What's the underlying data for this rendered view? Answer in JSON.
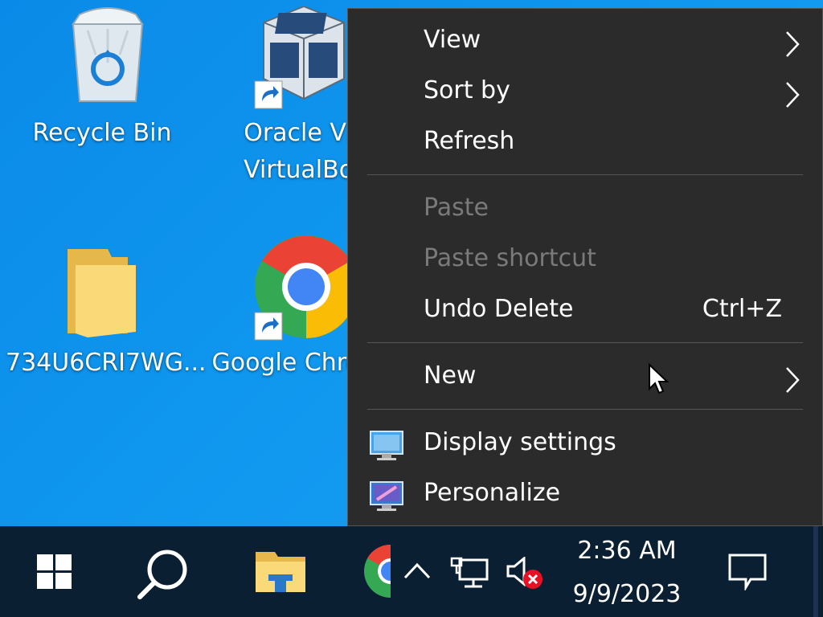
{
  "desktop": {
    "icons": [
      {
        "label_lines": [
          "Recycle Bin"
        ],
        "icon": "recycle-bin-icon"
      },
      {
        "label_lines": [
          "Oracle VM",
          "VirtualBox"
        ],
        "icon": "virtualbox-icon"
      },
      {
        "label_lines": [
          "734U6CRI7WG..."
        ],
        "icon": "folder-icon"
      },
      {
        "label_lines": [
          "Google Chrome"
        ],
        "icon": "chrome-icon"
      }
    ]
  },
  "context_menu": {
    "items": [
      {
        "label": "View",
        "has_submenu": true,
        "enabled": true
      },
      {
        "label": "Sort by",
        "has_submenu": true,
        "enabled": true
      },
      {
        "label": "Refresh",
        "enabled": true
      },
      {
        "label": "Paste",
        "enabled": false
      },
      {
        "label": "Paste shortcut",
        "enabled": false
      },
      {
        "label": "Undo Delete",
        "shortcut": "Ctrl+Z",
        "enabled": true
      },
      {
        "label": "New",
        "has_submenu": true,
        "enabled": true
      },
      {
        "label": "Display settings",
        "icon": "display-settings-icon",
        "enabled": true
      },
      {
        "label": "Personalize",
        "icon": "personalize-icon",
        "enabled": true
      }
    ]
  },
  "taskbar": {
    "time": "2:36 AM",
    "date": "9/9/2023",
    "pinned": [
      "start-icon",
      "search-icon",
      "file-explorer-icon",
      "chrome-icon"
    ],
    "tray": [
      "show-hidden-icons-chevron",
      "network-icon",
      "volume-muted-icon",
      "notifications-icon"
    ]
  },
  "colors": {
    "desktop_bg": "#0f96ee",
    "menu_bg": "#2b2b2b",
    "menu_disabled_text": "#7a7a7a",
    "taskbar_bg": "#0b1f33"
  }
}
